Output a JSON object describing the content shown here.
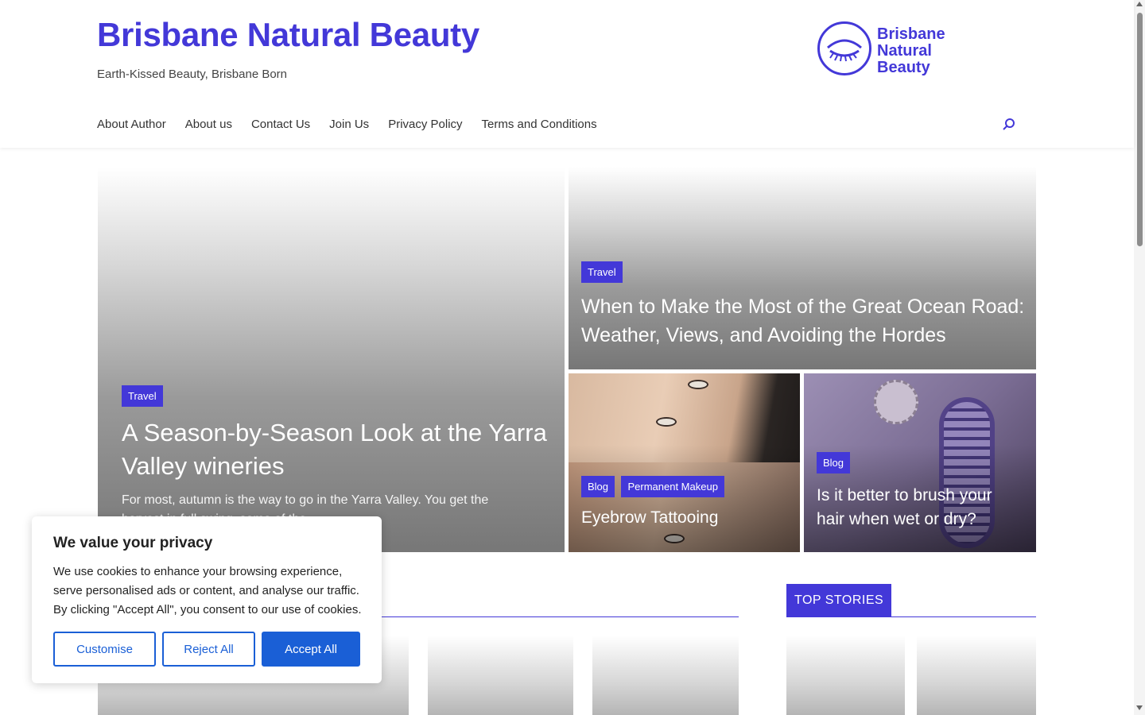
{
  "site": {
    "title": "Brisbane Natural Beauty",
    "tagline": "Earth-Kissed Beauty, Brisbane Born",
    "logo_lines": [
      "Brisbane",
      "Natural",
      "Beauty"
    ],
    "accent_color": "#4338d8"
  },
  "nav": {
    "items": [
      {
        "label": "About Author"
      },
      {
        "label": "About us"
      },
      {
        "label": "Contact Us"
      },
      {
        "label": "Join Us"
      },
      {
        "label": "Privacy Policy"
      },
      {
        "label": "Terms and Conditions"
      }
    ],
    "search_icon": "search-icon"
  },
  "hero": {
    "main": {
      "category": "Travel",
      "title": "A Season-by-Season Look at the Yarra Valley wineries",
      "excerpt": "For most, autumn is the way to go in the Yarra Valley. You get the harvest in full swing, some of the ..."
    },
    "top_right": {
      "category": "Travel",
      "title": "When to Make the Most of the Great Ocean Road: Weather, Views, and Avoiding the Hordes"
    },
    "bottom_left": {
      "categories": [
        "Blog",
        "Permanent Makeup"
      ],
      "title": "Eyebrow Tattooing"
    },
    "bottom_right": {
      "category": "Blog",
      "title": "Is it better to brush your hair when wet or dry?"
    }
  },
  "sidebar": {
    "top_stories_label": "TOP STORIES"
  },
  "cookie": {
    "title": "We value your privacy",
    "text": "We use cookies to enhance your browsing experience, serve personalised ads or content, and analyse our traffic. By clicking \"Accept All\", you consent to our use of cookies.",
    "customise_label": "Customise",
    "reject_label": "Reject All",
    "accept_label": "Accept All",
    "button_color": "#1a5fd6"
  }
}
